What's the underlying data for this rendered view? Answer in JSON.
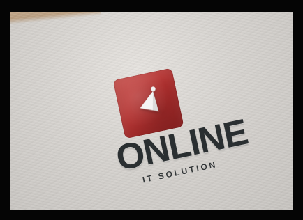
{
  "logo": {
    "name_text": "ONLINE",
    "tagline_text": "IT SOLUTION"
  },
  "colors": {
    "frame_black": "#050505",
    "paper": "#d8d5d1",
    "tile_red": "#b1302f",
    "text_charcoal": "#2a2f31",
    "wood": "#a97a47"
  }
}
